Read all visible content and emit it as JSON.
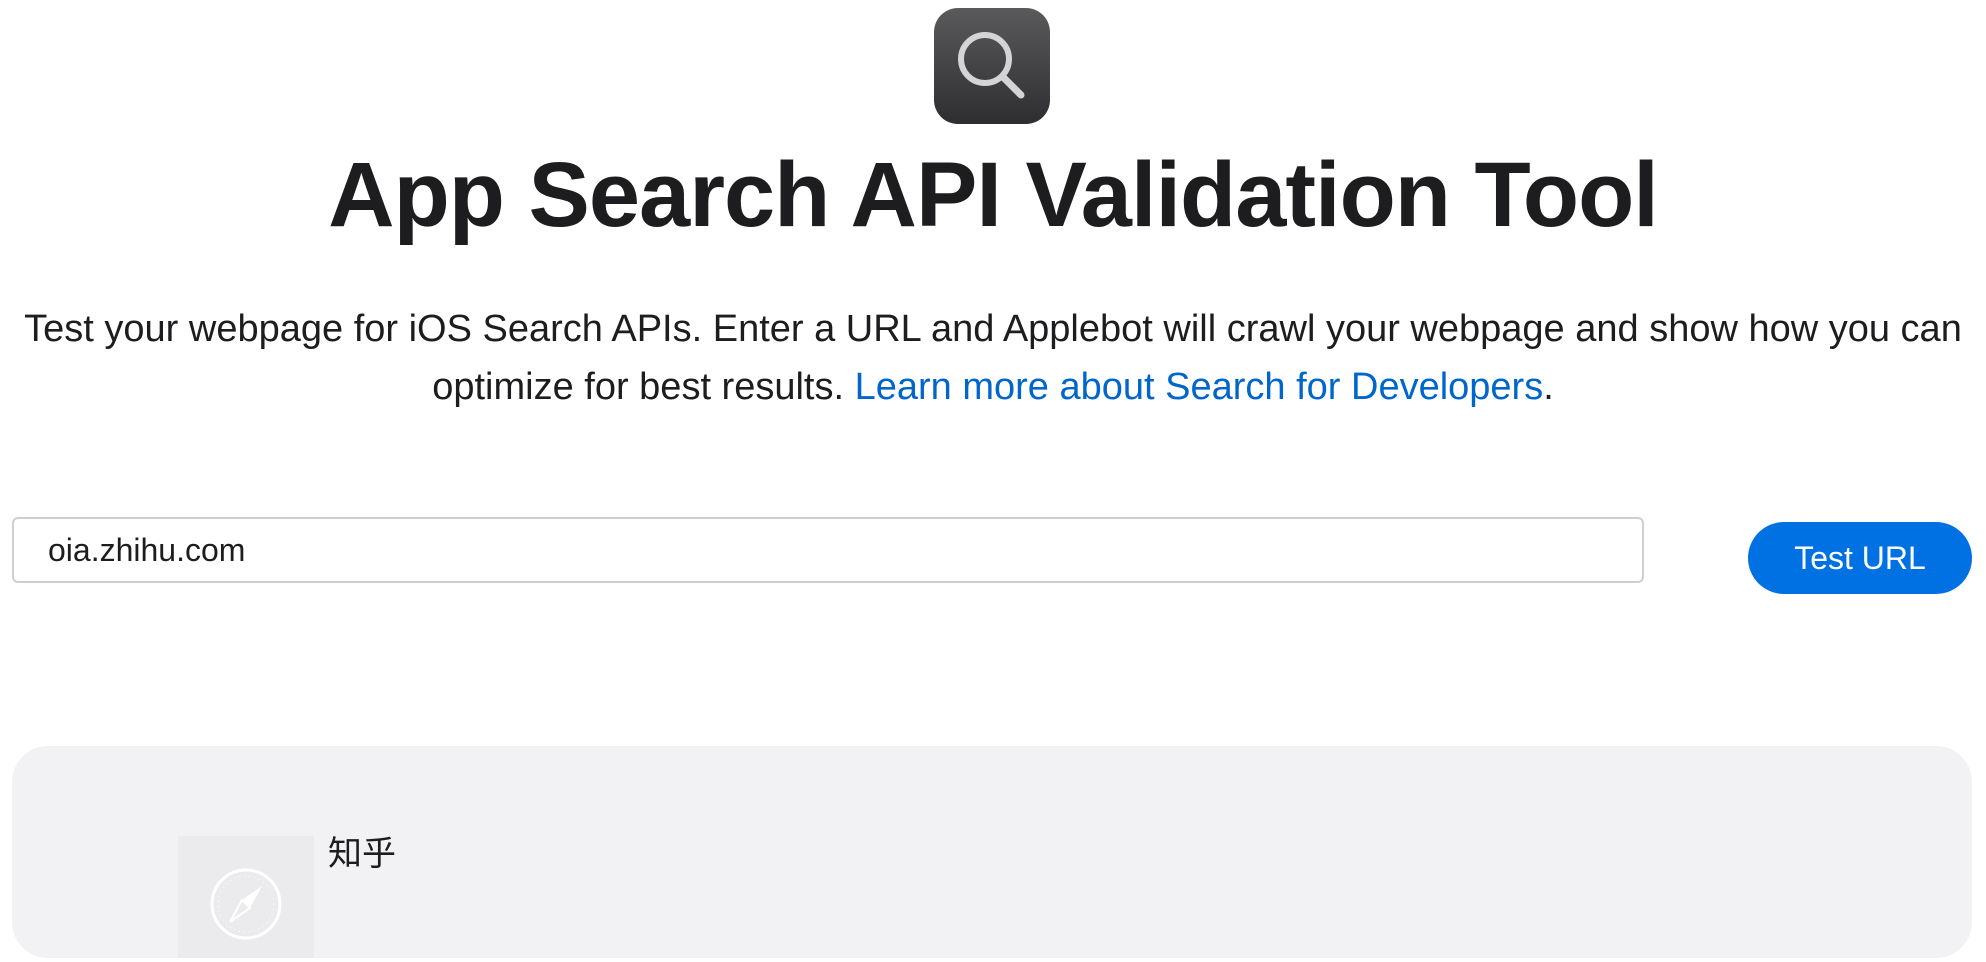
{
  "header": {
    "icon": "search-icon",
    "title": "App Search API Validation Tool",
    "intro_text": "Test your webpage for iOS Search APIs. Enter a URL and Applebot will crawl your webpage and show how you can optimize for best results. ",
    "learn_more_link": "Learn more about Search for Developers",
    "intro_end": "."
  },
  "form": {
    "url_value": "oia.zhihu.com",
    "test_button_label": "Test URL"
  },
  "result": {
    "thumbnail_icon": "compass-icon",
    "title": "知乎"
  },
  "colors": {
    "accent": "#0071e3",
    "link": "#0066cc",
    "card_bg": "#f2f2f4",
    "text": "#1d1d1f"
  }
}
